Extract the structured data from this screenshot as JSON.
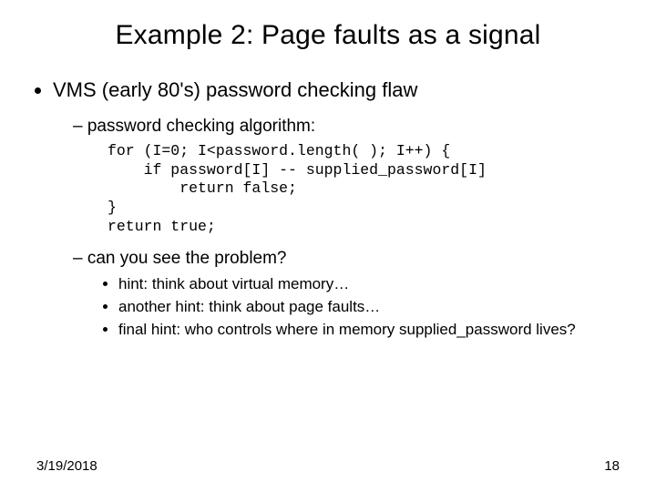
{
  "title": "Example 2:  Page faults as a signal",
  "bullet1": "VMS (early 80's) password checking flaw",
  "sub1": "password checking algorithm:",
  "code": "for (I=0; I<password.length( ); I++) {\n    if password[I] -- supplied_password[I]\n        return false;\n}\nreturn true;",
  "sub2": "can you see the problem?",
  "hints": [
    "hint: think about virtual memory…",
    "another hint:  think about page faults…",
    "final hint:  who controls where in memory supplied_password lives?"
  ],
  "footer": {
    "date": "3/19/2018",
    "page": "18"
  }
}
